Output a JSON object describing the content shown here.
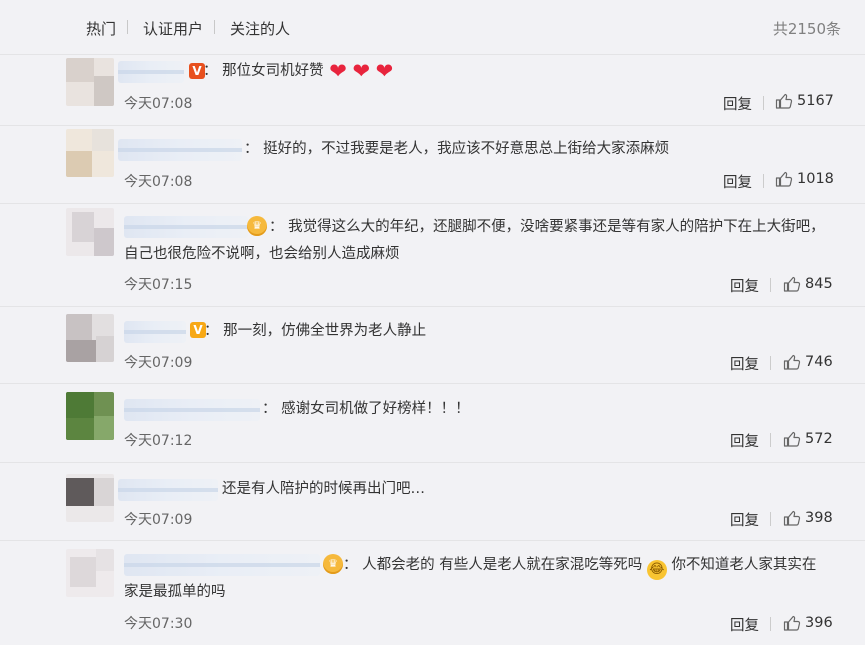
{
  "tabs": [
    {
      "label": "热门"
    },
    {
      "label": "认证用户"
    },
    {
      "label": "关注的人"
    }
  ],
  "total_count": "共2150条",
  "reply_label": "回复",
  "icons": {
    "like": "thumbs-up-icon",
    "heart": "red-heart-icon",
    "crown": "crown-badge-icon",
    "verified": "verified-v-icon",
    "emoji": "laughing-tears-emoji"
  },
  "colors": {
    "verified_red": "#e8501e",
    "verified_gold": "#f7a815",
    "heart": "#e8243d",
    "username_blur": "#dfe6f2"
  },
  "comments": [
    {
      "text": "：  那位女司机好赞",
      "emoji_suffix": "❤❤❤",
      "time": "今天07:08",
      "likes": "5167"
    },
    {
      "text": "：  挺好的，不过我要是老人，我应该不好意思总上街给大家添麻烦",
      "time": "今天07:08",
      "likes": "1018"
    },
    {
      "text_line1": "：  我觉得这么大的年纪，还腿脚不便，没啥要紧事还是等有家人的陪护下在上大街吧，",
      "text_line2": "自己也很危险不说啊，也会给别人造成麻烦",
      "time": "今天07:15",
      "likes": "845"
    },
    {
      "text": "：  那一刻，仿佛全世界为老人静止",
      "time": "今天07:09",
      "likes": "746"
    },
    {
      "text": "：  感谢女司机做了好榜样！！！",
      "time": "今天07:12",
      "likes": "572"
    },
    {
      "text": "还是有人陪护的时候再出门吧…",
      "time": "今天07:09",
      "likes": "398"
    },
    {
      "text_line1a": "：  人都会老的 有些人是老人就在家混吃等死吗",
      "text_line1b": "你不知道老人家其实在",
      "text_line2": "家是最孤单的吗",
      "time": "今天07:30",
      "likes": "396"
    }
  ]
}
